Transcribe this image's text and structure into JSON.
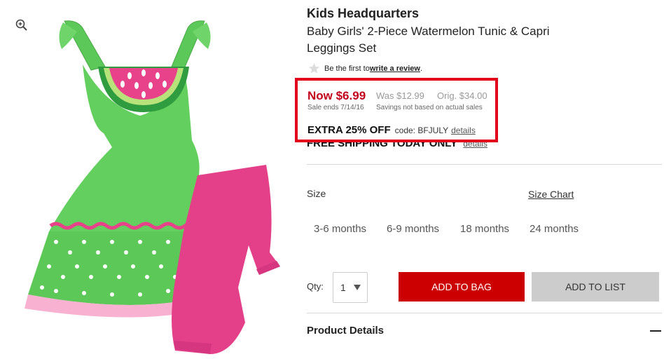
{
  "product": {
    "brand": "Kids Headquarters",
    "title": "Baby Girls' 2-Piece Watermelon Tunic & Capri Leggings Set"
  },
  "review": {
    "prefix": "Be the first to ",
    "link": "write a review",
    "suffix": "."
  },
  "pricing": {
    "now": "Now $6.99",
    "was": "Was $12.99",
    "orig": "Orig. $34.00",
    "sale_ends": "Sale ends 7/14/16",
    "savings_note": "Savings not based on actual sales",
    "extra_off": "EXTRA 25% OFF",
    "promo_code": "code: BFJULY",
    "details_label": "details",
    "highlight_color": "#e3001b"
  },
  "shipping": {
    "text": "FREE SHIPPING TODAY ONLY",
    "details_label": "details"
  },
  "size": {
    "label": "Size",
    "chart_label": "Size Chart",
    "options": [
      "3-6 months",
      "6-9 months",
      "18 months",
      "24 months"
    ]
  },
  "quantity": {
    "label": "Qty:",
    "value": "1"
  },
  "actions": {
    "add_to_bag": "ADD TO BAG",
    "add_to_list": "ADD TO LIST",
    "bag_color": "#cc0000",
    "list_color": "#cccccc"
  },
  "details_section": {
    "title": "Product Details"
  },
  "icons": {
    "zoom": "zoom-in-icon",
    "star": "star-icon",
    "collapse": "minus-icon",
    "dropdown": "chevron-down-icon"
  }
}
